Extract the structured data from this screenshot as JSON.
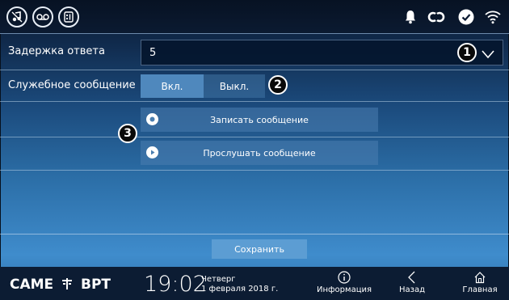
{
  "topbar": {
    "icons": [
      "music-off-icon",
      "voicemail-icon",
      "intercom-icon"
    ],
    "status_icons": [
      "bell-icon",
      "link-icon",
      "check-icon",
      "wifi-icon"
    ]
  },
  "settings": {
    "response_delay": {
      "label": "Задержка ответа",
      "value": "5"
    },
    "service_message": {
      "label": "Служебное сообщение",
      "on_label": "Вкл.",
      "off_label": "Выкл.",
      "selected": "Вкл."
    },
    "record_label": "Записать сообщение",
    "play_label": "Прослушать сообщение",
    "save_label": "Сохранить"
  },
  "callouts": [
    "1",
    "2",
    "3"
  ],
  "bottombar": {
    "logo_left": "CAME",
    "logo_right": "BPT",
    "time": "19:02",
    "day": "Четверг",
    "date": "1 февраля 2018 г.",
    "nav": {
      "info": "Информация",
      "back": "Назад",
      "home": "Главная"
    }
  },
  "colors": {
    "accent": "#5c9dd3",
    "topbar": "#0b1a31",
    "bottombar": "#0c1c33"
  }
}
